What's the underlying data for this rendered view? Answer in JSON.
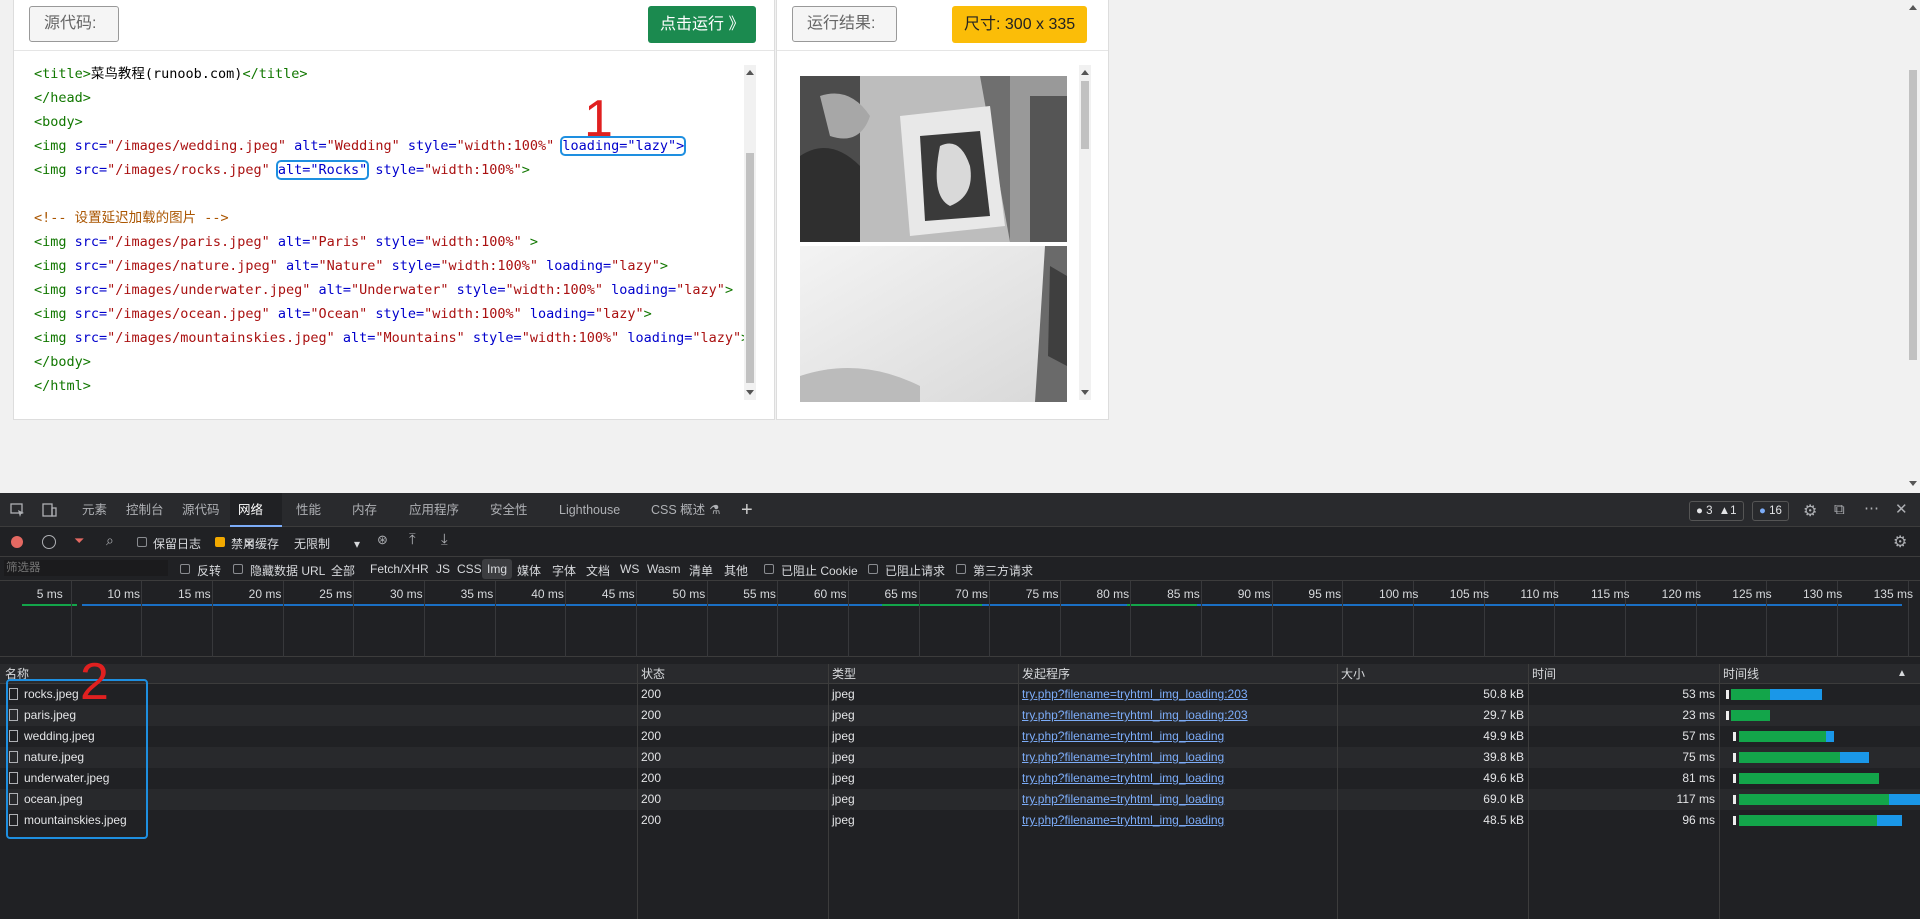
{
  "editor": {
    "source_label": "源代码:",
    "run_label": "点击运行 》",
    "result_label": "运行结果:",
    "size_label": "尺寸: 300 x 335",
    "code_lines": [
      [
        {
          "t": "<title>",
          "c": "tg"
        },
        {
          "t": "菜鸟教程(runoob.com)",
          "c": "tx"
        },
        {
          "t": "</title>",
          "c": "tg"
        }
      ],
      [
        {
          "t": "</head>",
          "c": "tg"
        }
      ],
      [
        {
          "t": "<body>",
          "c": "tg"
        }
      ],
      [
        {
          "t": "<img ",
          "c": "tg"
        },
        {
          "t": "src=",
          "c": "at"
        },
        {
          "t": "\"/images/wedding.jpeg\"",
          "c": "st"
        },
        {
          "t": " alt=",
          "c": "at"
        },
        {
          "t": "\"Wedding\"",
          "c": "st"
        },
        {
          "t": " style=",
          "c": "at"
        },
        {
          "t": "\"width:100%\"",
          "c": "st"
        },
        {
          "t": " ",
          "c": "tx"
        },
        {
          "t": "loading=\"lazy\">",
          "c": "at",
          "h": true
        }
      ],
      [
        {
          "t": "<img ",
          "c": "tg"
        },
        {
          "t": "src=",
          "c": "at"
        },
        {
          "t": "\"/images/rocks.jpeg\"",
          "c": "st"
        },
        {
          "t": " ",
          "c": "tx"
        },
        {
          "t": "alt=\"Rocks\"",
          "c": "at",
          "h": true
        },
        {
          "t": " style=",
          "c": "at"
        },
        {
          "t": "\"width:100%\"",
          "c": "st"
        },
        {
          "t": ">",
          "c": "tg"
        }
      ],
      [],
      [
        {
          "t": "<!-- 设置延迟加载的图片 -->",
          "c": "cm"
        }
      ],
      [
        {
          "t": "<img ",
          "c": "tg"
        },
        {
          "t": "src=",
          "c": "at"
        },
        {
          "t": "\"/images/paris.jpeg\"",
          "c": "st"
        },
        {
          "t": " alt=",
          "c": "at"
        },
        {
          "t": "\"Paris\"",
          "c": "st"
        },
        {
          "t": " style=",
          "c": "at"
        },
        {
          "t": "\"width:100%\"",
          "c": "st"
        },
        {
          "t": " >",
          "c": "tg"
        }
      ],
      [
        {
          "t": "<img ",
          "c": "tg"
        },
        {
          "t": "src=",
          "c": "at"
        },
        {
          "t": "\"/images/nature.jpeg\"",
          "c": "st"
        },
        {
          "t": " alt=",
          "c": "at"
        },
        {
          "t": "\"Nature\"",
          "c": "st"
        },
        {
          "t": " style=",
          "c": "at"
        },
        {
          "t": "\"width:100%\"",
          "c": "st"
        },
        {
          "t": " loading=",
          "c": "at"
        },
        {
          "t": "\"lazy\"",
          "c": "st"
        },
        {
          "t": ">",
          "c": "tg"
        }
      ],
      [
        {
          "t": "<img ",
          "c": "tg"
        },
        {
          "t": "src=",
          "c": "at"
        },
        {
          "t": "\"/images/underwater.jpeg\"",
          "c": "st"
        },
        {
          "t": " alt=",
          "c": "at"
        },
        {
          "t": "\"Underwater\"",
          "c": "st"
        },
        {
          "t": " style=",
          "c": "at"
        },
        {
          "t": "\"width:100%\"",
          "c": "st"
        },
        {
          "t": " loading=",
          "c": "at"
        },
        {
          "t": "\"lazy\"",
          "c": "st"
        },
        {
          "t": ">",
          "c": "tg"
        }
      ],
      [
        {
          "t": "<img ",
          "c": "tg"
        },
        {
          "t": "src=",
          "c": "at"
        },
        {
          "t": "\"/images/ocean.jpeg\"",
          "c": "st"
        },
        {
          "t": " alt=",
          "c": "at"
        },
        {
          "t": "\"Ocean\"",
          "c": "st"
        },
        {
          "t": " style=",
          "c": "at"
        },
        {
          "t": "\"width:100%\"",
          "c": "st"
        },
        {
          "t": " loading=",
          "c": "at"
        },
        {
          "t": "\"lazy\"",
          "c": "st"
        },
        {
          "t": ">",
          "c": "tg"
        }
      ],
      [
        {
          "t": "<img ",
          "c": "tg"
        },
        {
          "t": "src=",
          "c": "at"
        },
        {
          "t": "\"/images/mountainskies.jpeg\"",
          "c": "st"
        },
        {
          "t": " alt=",
          "c": "at"
        },
        {
          "t": "\"Mountains\"",
          "c": "st"
        },
        {
          "t": " style=",
          "c": "at"
        },
        {
          "t": "\"width:100%\"",
          "c": "st"
        },
        {
          "t": " loading=",
          "c": "at"
        },
        {
          "t": "\"lazy\"",
          "c": "st"
        },
        {
          "t": ">",
          "c": "tg"
        }
      ],
      [
        {
          "t": "</body>",
          "c": "tg"
        }
      ],
      [
        {
          "t": "</html>",
          "c": "tg"
        }
      ]
    ]
  },
  "annotations": {
    "one": "1",
    "two": "2"
  },
  "devtools": {
    "tabs": [
      "元素",
      "控制台",
      "源代码",
      "网络",
      "性能",
      "内存",
      "应用程序",
      "安全性",
      "Lighthouse",
      "CSS 概述"
    ],
    "active_tab": "网络",
    "status_counts": {
      "issues": "3",
      "warnings": "1",
      "messages": "16"
    },
    "toolbar": {
      "preserve_log": "保留日志",
      "disable_cache": "禁用缓存",
      "throttle": "无限制"
    },
    "filter": {
      "placeholder": "筛选器",
      "invert": "反转",
      "hide_data_url": "隐藏数据 URL",
      "types": [
        "全部",
        "Fetch/XHR",
        "JS",
        "CSS",
        "Img",
        "媒体",
        "字体",
        "文档",
        "WS",
        "Wasm",
        "清单",
        "其他"
      ],
      "active_type": "Img",
      "blocked_cookies": "已阻止 Cookie",
      "blocked_requests": "已阻止请求",
      "third_party": "第三方请求"
    },
    "timeline_ticks": [
      "5 ms",
      "10 ms",
      "15 ms",
      "20 ms",
      "25 ms",
      "30 ms",
      "35 ms",
      "40 ms",
      "45 ms",
      "50 ms",
      "55 ms",
      "60 ms",
      "65 ms",
      "70 ms",
      "75 ms",
      "80 ms",
      "85 ms",
      "90 ms",
      "95 ms",
      "100 ms",
      "105 ms",
      "110 ms",
      "115 ms",
      "120 ms",
      "125 ms",
      "130 ms",
      "135 ms"
    ],
    "columns": {
      "name": "名称",
      "status": "状态",
      "type": "类型",
      "initiator": "发起程序",
      "size": "大小",
      "time": "时间",
      "waterfall": "时间线"
    },
    "rows": [
      {
        "name": "rocks.jpeg",
        "status": "200",
        "type": "jpeg",
        "initiator": "try.php?filename=tryhtml_img_loading:203",
        "size": "50.8 kB",
        "time": "53 ms",
        "q": 0.005,
        "w0": 0.03,
        "w1": 0.23,
        "w2": 0.5
      },
      {
        "name": "paris.jpeg",
        "status": "200",
        "type": "jpeg",
        "initiator": "try.php?filename=tryhtml_img_loading:203",
        "size": "29.7 kB",
        "time": "23 ms",
        "q": 0.005,
        "w0": 0.03,
        "w1": 0.23,
        "w2": 0.23
      },
      {
        "name": "wedding.jpeg",
        "status": "200",
        "type": "jpeg",
        "initiator": "try.php?filename=tryhtml_img_loading",
        "size": "49.9 kB",
        "time": "57 ms",
        "q": 0.04,
        "w0": 0.07,
        "w1": 0.52,
        "w2": 0.56
      },
      {
        "name": "nature.jpeg",
        "status": "200",
        "type": "jpeg",
        "initiator": "try.php?filename=tryhtml_img_loading",
        "size": "39.8 kB",
        "time": "75 ms",
        "q": 0.04,
        "w0": 0.07,
        "w1": 0.59,
        "w2": 0.74
      },
      {
        "name": "underwater.jpeg",
        "status": "200",
        "type": "jpeg",
        "initiator": "try.php?filename=tryhtml_img_loading",
        "size": "49.6 kB",
        "time": "81 ms",
        "q": 0.04,
        "w0": 0.07,
        "w1": 0.79,
        "w2": 0.79
      },
      {
        "name": "ocean.jpeg",
        "status": "200",
        "type": "jpeg",
        "initiator": "try.php?filename=tryhtml_img_loading",
        "size": "69.0 kB",
        "time": "117 ms",
        "q": 0.04,
        "w0": 0.07,
        "w1": 0.84,
        "w2": 1.0
      },
      {
        "name": "mountainskies.jpeg",
        "status": "200",
        "type": "jpeg",
        "initiator": "try.php?filename=tryhtml_img_loading",
        "size": "48.5 kB",
        "time": "96 ms",
        "q": 0.04,
        "w0": 0.07,
        "w1": 0.78,
        "w2": 0.91
      }
    ]
  }
}
